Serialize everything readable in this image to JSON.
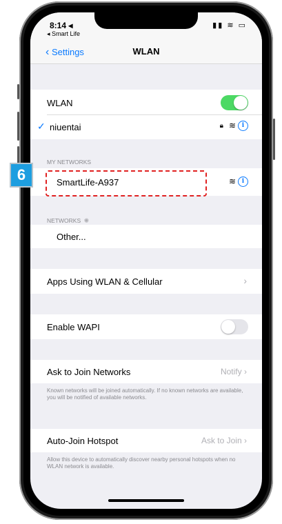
{
  "status_bar": {
    "time": "8:14 ◂",
    "back_app": "◂ Smart Life",
    "icons": "▮▮ ≋ ▭"
  },
  "nav": {
    "back_label": "Settings",
    "title": "WLAN"
  },
  "wlan": {
    "label": "WLAN",
    "enabled": true,
    "connected_network": "niuentai"
  },
  "my_networks": {
    "header": "MY NETWORKS",
    "items": [
      {
        "name": "SmartLife-A937"
      }
    ]
  },
  "networks": {
    "header": "NETWORKS",
    "other_label": "Other..."
  },
  "apps_using": {
    "label": "Apps Using WLAN & Cellular"
  },
  "wapi": {
    "label": "Enable WAPI",
    "enabled": false
  },
  "ask_to_join": {
    "label": "Ask to Join Networks",
    "value": "Notify",
    "footer": "Known networks will be joined automatically. If no known networks are available, you will be notified of available networks."
  },
  "auto_join": {
    "label": "Auto-Join Hotspot",
    "value": "Ask to Join",
    "footer": "Allow this device to automatically discover nearby personal hotspots when no WLAN network is available."
  },
  "step_badge": "6",
  "colors": {
    "accent": "#0a7aff",
    "toggle_on": "#4cd964",
    "highlight": "#e02020",
    "badge": "#1d9ee0"
  }
}
